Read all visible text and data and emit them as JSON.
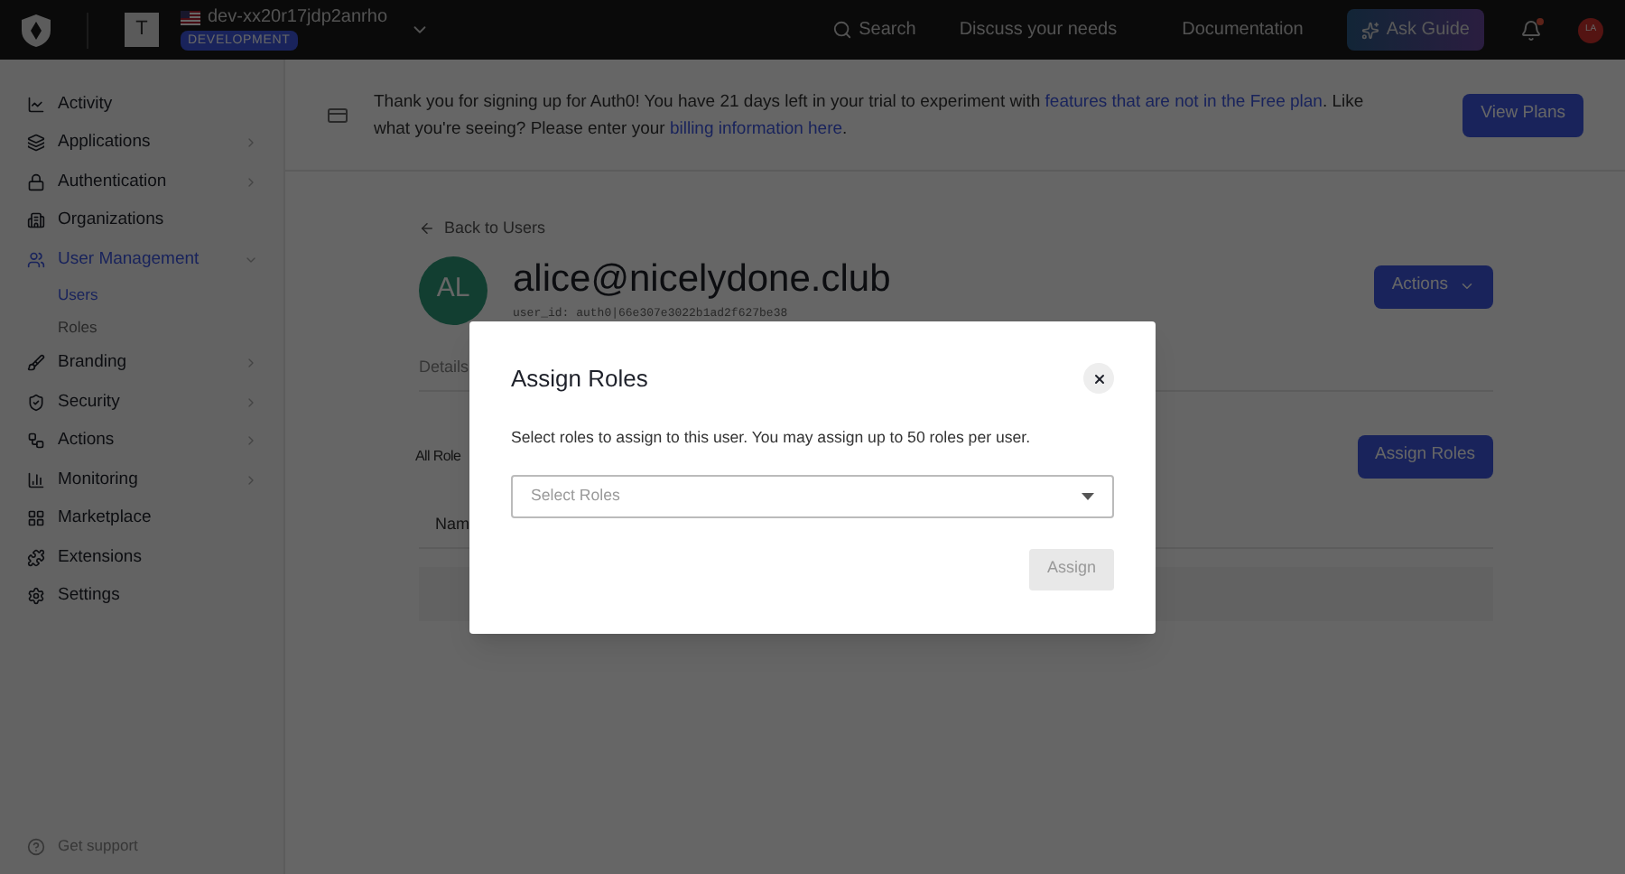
{
  "topbar": {
    "tenant_initial": "T",
    "tenant_name": "dev-xx20r17jdp2anrho",
    "environment": "DEVELOPMENT",
    "search": "Search",
    "links": [
      "Discuss your needs",
      "Documentation"
    ],
    "ask_guide": "Ask Guide",
    "has_notification": true,
    "avatar": "LA"
  },
  "sidebar": {
    "items": [
      {
        "label": "Activity",
        "expandable": false,
        "selected": false
      },
      {
        "label": "Applications",
        "expandable": true,
        "selected": false
      },
      {
        "label": "Authentication",
        "expandable": true,
        "selected": false
      },
      {
        "label": "Organizations",
        "expandable": false,
        "selected": false
      },
      {
        "label": "User Management",
        "expandable": true,
        "expanded": true,
        "selected": true,
        "children": [
          {
            "label": "Users",
            "selected": true
          },
          {
            "label": "Roles",
            "selected": false
          }
        ]
      },
      {
        "label": "Branding",
        "expandable": true,
        "selected": false
      },
      {
        "label": "Security",
        "expandable": true,
        "selected": false
      },
      {
        "label": "Actions",
        "expandable": true,
        "selected": false
      },
      {
        "label": "Monitoring",
        "expandable": true,
        "selected": false
      },
      {
        "label": "Marketplace",
        "expandable": false,
        "selected": false
      },
      {
        "label": "Extensions",
        "expandable": false,
        "selected": false
      },
      {
        "label": "Settings",
        "expandable": false,
        "selected": false
      }
    ],
    "support": "Get support"
  },
  "banner": {
    "segments": [
      {
        "kind": "plain",
        "text": "Thank you for signing up for Auth0! You have 21 days left in your trial to experiment with"
      },
      {
        "kind": "link",
        "text": "features that are not in the Free plan"
      },
      {
        "kind": "plain",
        "text": ". Like what you're seeing? Please enter your"
      },
      {
        "kind": "link",
        "text": "billing information here"
      },
      {
        "kind": "plain",
        "text": "."
      }
    ],
    "button": "View Plans"
  },
  "user": {
    "back_link": "Back to Users",
    "initials": "AL",
    "email": "alice@nicelydone.club",
    "user_id": "user_id: auth0|66e307e3022b1ad2f627be38",
    "actions_button": "Actions"
  },
  "tabs": [
    {
      "label": "Details",
      "selected": false
    }
  ],
  "roles": {
    "title": "All Role",
    "button": "Assign Roles",
    "columns": [
      "Nam"
    ]
  },
  "modal": {
    "title": "Assign Roles",
    "description": "Select roles to assign to this user. You may assign up to 50 roles per user.",
    "select_placeholder": "Select Roles",
    "button": "Assign",
    "button_disabled": true
  }
}
